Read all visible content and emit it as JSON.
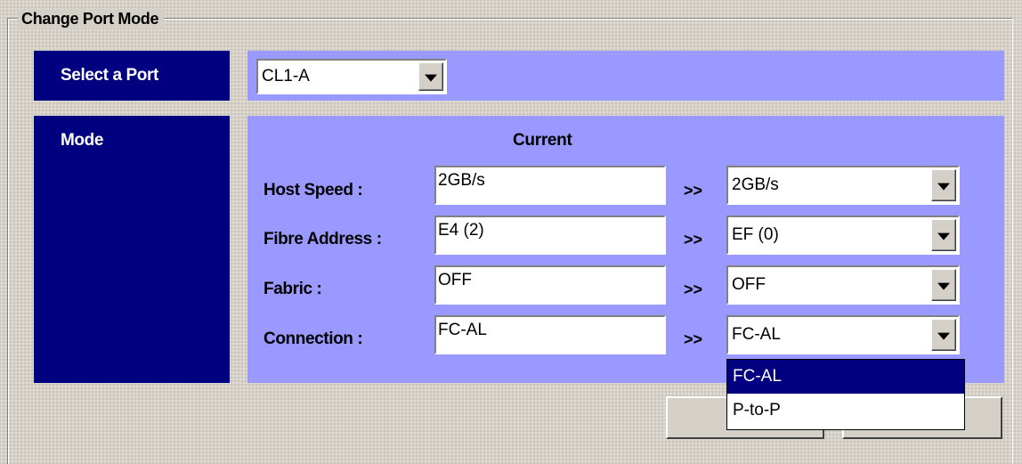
{
  "group_title": "Change Port Mode",
  "select_port": {
    "label": "Select a Port",
    "value": "CL1-A"
  },
  "mode": {
    "label": "Mode",
    "current_header": "Current",
    "separator": ">>",
    "rows": [
      {
        "label": "Host Speed :",
        "current": "2GB/s",
        "new": "2GB/s"
      },
      {
        "label": "Fibre Address :",
        "current": "E4 (2)",
        "new": "EF (0)"
      },
      {
        "label": "Fabric :",
        "current": "OFF",
        "new": "OFF"
      },
      {
        "label": "Connection :",
        "current": "FC-AL",
        "new": "FC-AL"
      }
    ]
  },
  "connection_dropdown": {
    "options": [
      "FC-AL",
      "P-to-P"
    ],
    "highlighted": "FC-AL"
  },
  "colors": {
    "label_bg": "#000080",
    "panel_bg": "#9999ff",
    "window_bg": "#d4d0c8",
    "selection": "#000080"
  },
  "icons": {
    "dropdown": "chevron-down-icon"
  }
}
